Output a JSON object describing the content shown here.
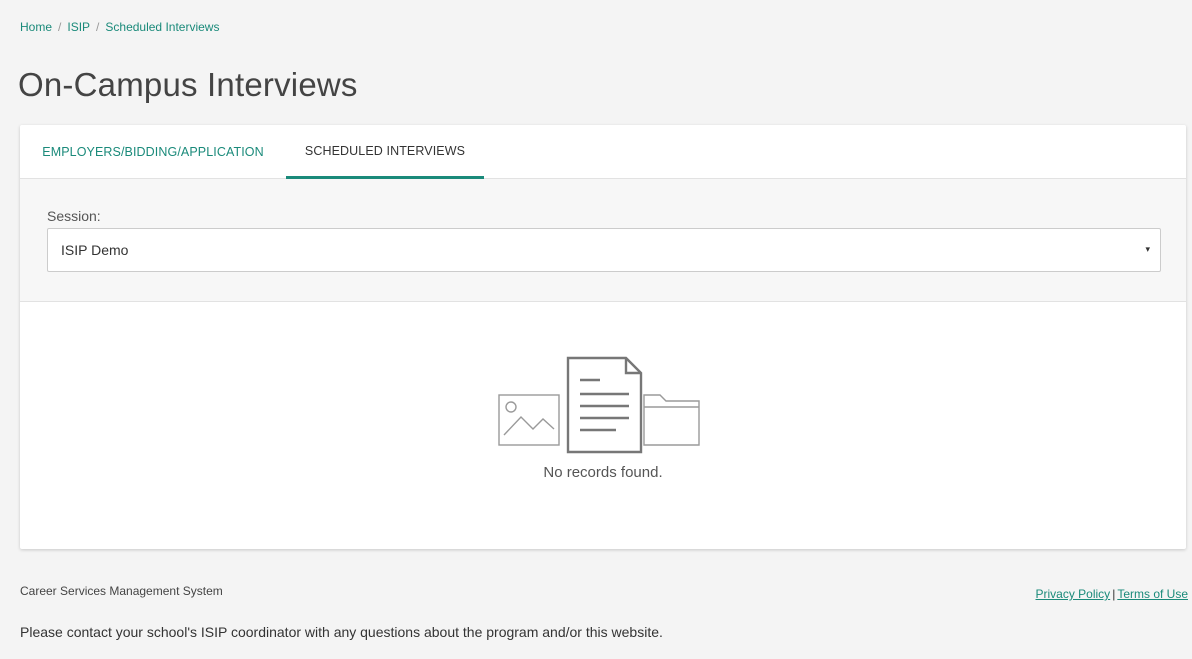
{
  "breadcrumb": {
    "items": [
      "Home",
      "ISIP",
      "Scheduled Interviews"
    ],
    "separator": "/"
  },
  "page": {
    "title": "On-Campus Interviews"
  },
  "tabs": [
    {
      "label": "EMPLOYERS/BIDDING/APPLICATION",
      "active": false
    },
    {
      "label": "SCHEDULED INTERVIEWS",
      "active": true
    }
  ],
  "session": {
    "label": "Session:",
    "selected": "ISIP Demo",
    "arrow": "▾"
  },
  "empty_state": {
    "message": "No records found.",
    "icons": [
      "image-icon",
      "document-icon",
      "folder-icon"
    ]
  },
  "footer": {
    "system_name": "Career Services Management System",
    "privacy_label": "Privacy Policy",
    "divider": "|",
    "terms_label": "Terms of Use",
    "note": "Please contact your school's ISIP coordinator with any questions about the program and/or this website."
  },
  "colors": {
    "accent": "#1a8a7a",
    "background": "#f4f4f4",
    "card": "#ffffff"
  }
}
